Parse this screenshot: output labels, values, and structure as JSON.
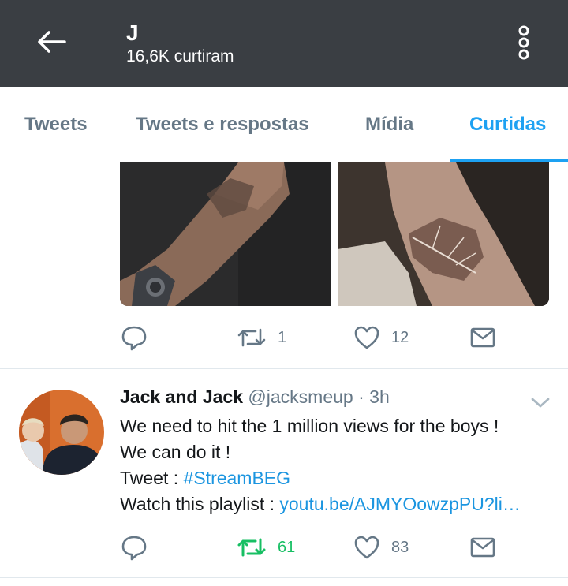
{
  "header": {
    "title": "J",
    "subtitle": "16,6K curtiram"
  },
  "tabs": [
    {
      "label": "Tweets",
      "active": false
    },
    {
      "label": "Tweets e respostas",
      "active": false
    },
    {
      "label": "Mídia",
      "active": false
    },
    {
      "label": "Curtidas",
      "active": true
    }
  ],
  "tweet1": {
    "retweets": "1",
    "likes": "12"
  },
  "tweet2": {
    "name": "Jack and Jack",
    "handle": "@jacksmeup",
    "separator": "·",
    "time": "3h",
    "line1": "We need to hit the 1 million views for the boys !",
    "line2": "We can do it !",
    "line3_prefix": "Tweet : ",
    "hashtag": "#StreamBEG",
    "line4_prefix": "Watch this playlist : ",
    "link": "youtu.be/AJMYOowzpPU?li…",
    "retweets": "61",
    "likes": "83"
  },
  "colors": {
    "appbar": "#3a3e43",
    "accent": "#1da1f2",
    "retweet_active": "#17bf63",
    "muted": "#657786"
  },
  "icons": [
    "back-arrow-icon",
    "more-vertical-icon",
    "reply-icon",
    "retweet-icon",
    "like-icon",
    "direct-message-icon",
    "chevron-down-icon"
  ]
}
